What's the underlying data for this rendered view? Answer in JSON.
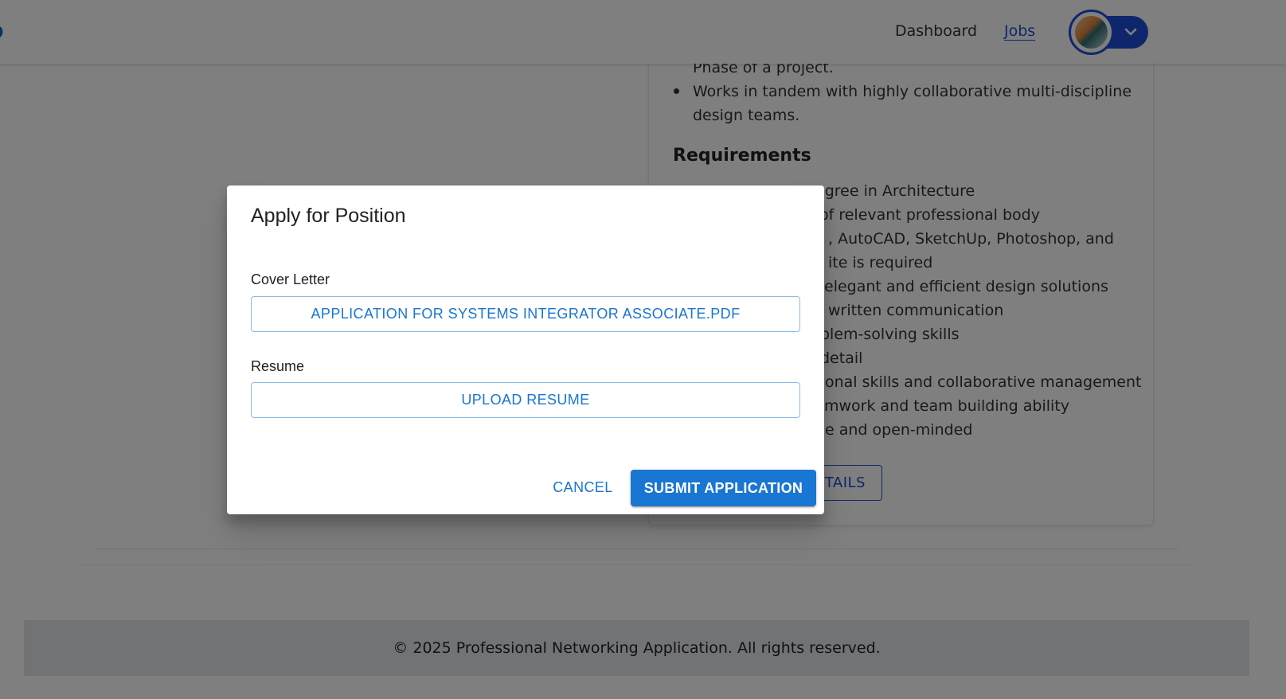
{
  "navbar": {
    "brand_fragment": "p",
    "links": [
      "Dashboard",
      "Jobs"
    ],
    "active_link": "Jobs"
  },
  "job_card": {
    "responsibilities_tail": [
      "Phase of a project.",
      "Works in tandem with highly collaborative multi-discipline",
      "design teams."
    ],
    "requirements_title": "Requirements",
    "requirements_visible_fragments": [
      "egree in Architecture",
      "of relevant professional body",
      ", AutoCAD, SketchUp, Photoshop, and",
      "ite is required",
      "elegant and efficient design solutions",
      "written communication",
      "blem-solving skills",
      "detail",
      "onal skills and collaborative management",
      "mwork and team building ability",
      "e and open-minded"
    ],
    "details_button_fragment": "TAILS"
  },
  "footer": {
    "text": "© 2025 Professional Networking Application. All rights reserved."
  },
  "dialog": {
    "title": "Apply for Position",
    "cover_letter": {
      "label": "Cover Letter",
      "button_label": "APPLICATION FOR SYSTEMS INTEGRATOR ASSOCIATE.PDF"
    },
    "resume": {
      "label": "Resume",
      "button_label": "UPLOAD RESUME"
    },
    "cancel_label": "CANCEL",
    "submit_label": "SUBMIT APPLICATION"
  },
  "colors": {
    "primary": "#1976d2",
    "nav_accent": "#1d4ed8",
    "backdrop": "rgba(0,0,0,0.5)",
    "footer_bg": "#e5e7eb"
  },
  "icons": [
    "avatar",
    "chevron-down-icon"
  ]
}
